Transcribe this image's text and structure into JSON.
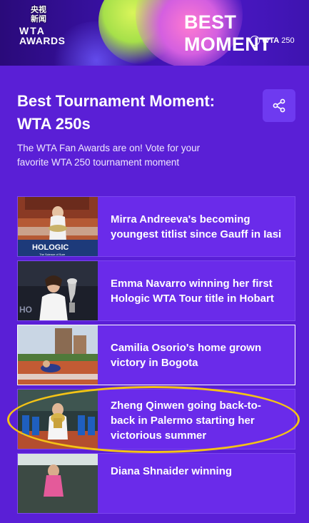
{
  "banner": {
    "badge_top": "央视",
    "badge_bottom": "新闻",
    "wta_line1": "WTA",
    "wta_line2": "AWARDS",
    "headline": "BEST MOMENT",
    "wta250_w": "WTA",
    "wta250_num": "250"
  },
  "header": {
    "title_line1": "Best Tournament Moment:",
    "title_line2": "WTA 250s",
    "description": "The WTA Fan Awards are on! Vote for your favorite WTA 250 tournament moment"
  },
  "thumb_texts": {
    "card1_sponsor": "HOLOGIC",
    "card1_sponsor_sub": "The Science of Sure",
    "card2_sponsor": "HO"
  },
  "moments": [
    {
      "label": "Mirra Andreeva's becoming youngest titlist since Gauff in Iasi"
    },
    {
      "label": "Emma Navarro winning her first Hologic WTA Tour title in Hobart"
    },
    {
      "label": "Camilia Osorio's home grown victory in Bogota"
    },
    {
      "label": "Zheng Qinwen going back-to-back in Palermo starting her victorious summer"
    },
    {
      "label": "Diana Shnaider winning"
    }
  ],
  "colors": {
    "background": "#5a1fd6",
    "card": "#6a2bea",
    "highlight_ellipse": "#f4c316"
  },
  "icons": {
    "share": "share-icon"
  }
}
